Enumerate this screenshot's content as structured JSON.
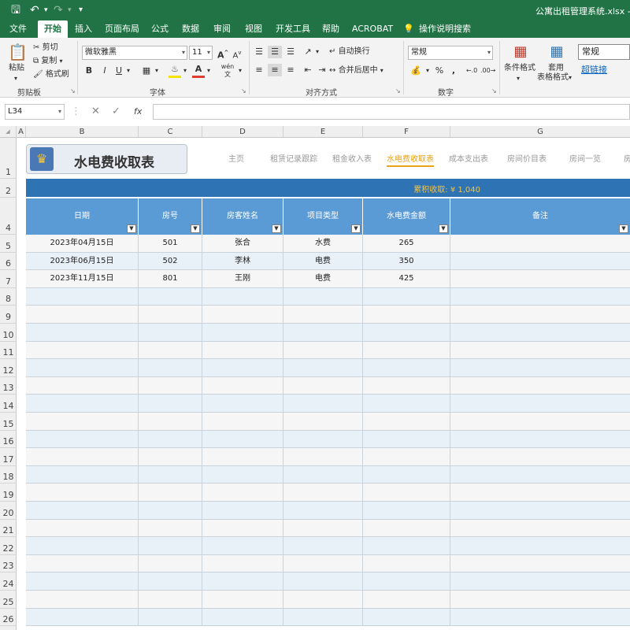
{
  "titlebar": {
    "quick_access": [
      "save-icon",
      "undo-icon",
      "redo-icon"
    ],
    "doc_title": "公寓出租管理系统.xlsx  -  Exc"
  },
  "ribbon_tabs": [
    "文件",
    "开始",
    "插入",
    "页面布局",
    "公式",
    "数据",
    "审阅",
    "视图",
    "开发工具",
    "帮助",
    "ACROBAT",
    "操作说明搜索"
  ],
  "active_tab": "开始",
  "clipboard": {
    "paste": "粘贴",
    "cut": "剪切",
    "copy": "复制",
    "format_painter": "格式刷",
    "label": "剪贴板"
  },
  "font": {
    "name": "微软雅黑",
    "size": "11",
    "bold": "B",
    "italic": "I",
    "underline": "U",
    "label": "字体",
    "phonetic": "wén"
  },
  "alignment": {
    "wrap": "自动换行",
    "merge": "合并后居中",
    "label": "对齐方式"
  },
  "number": {
    "format": "常规",
    "label": "数字",
    "percent": "%",
    "comma": ","
  },
  "styles": {
    "conditional": "条件格式",
    "table_format_1": "套用",
    "table_format_2": "表格格式",
    "cell_style_normal": "常规",
    "cell_style_link": "超链接"
  },
  "formula_bar": {
    "name_box": "L34",
    "cancel": "✕",
    "enter": "✓",
    "fx": "fx",
    "value": ""
  },
  "columns": [
    "A",
    "B",
    "C",
    "D",
    "E",
    "F",
    "G"
  ],
  "rows": [
    "1",
    "2",
    "4",
    "5",
    "6",
    "7",
    "8",
    "9",
    "10",
    "11",
    "12",
    "13",
    "14",
    "15",
    "16",
    "17",
    "18",
    "19",
    "20",
    "21",
    "22",
    "23",
    "24",
    "25",
    "26"
  ],
  "sheet": {
    "title": "水电费收取表",
    "nav": [
      "主页",
      "租赁记录跟踪",
      "租金收入表",
      "水电费收取表",
      "成本支出表",
      "房间价目表",
      "房间一览",
      "房"
    ],
    "active_nav": "水电费收取表",
    "summary": "累积收取:   ¥ 1,040",
    "headers": [
      "日期",
      "房号",
      "房客姓名",
      "项目类型",
      "水电费金额",
      "备注"
    ],
    "records": [
      [
        "2023年04月15日",
        "501",
        "张合",
        "水费",
        "265",
        ""
      ],
      [
        "2023年06月15日",
        "502",
        "李林",
        "电费",
        "350",
        ""
      ],
      [
        "2023年11月15日",
        "801",
        "王刚",
        "电费",
        "425",
        ""
      ]
    ]
  },
  "colors": {
    "excel_green": "#217346",
    "header_blue": "#5b9bd5",
    "summary_blue": "#2e74b5",
    "accent_gold": "#e8a21c"
  }
}
